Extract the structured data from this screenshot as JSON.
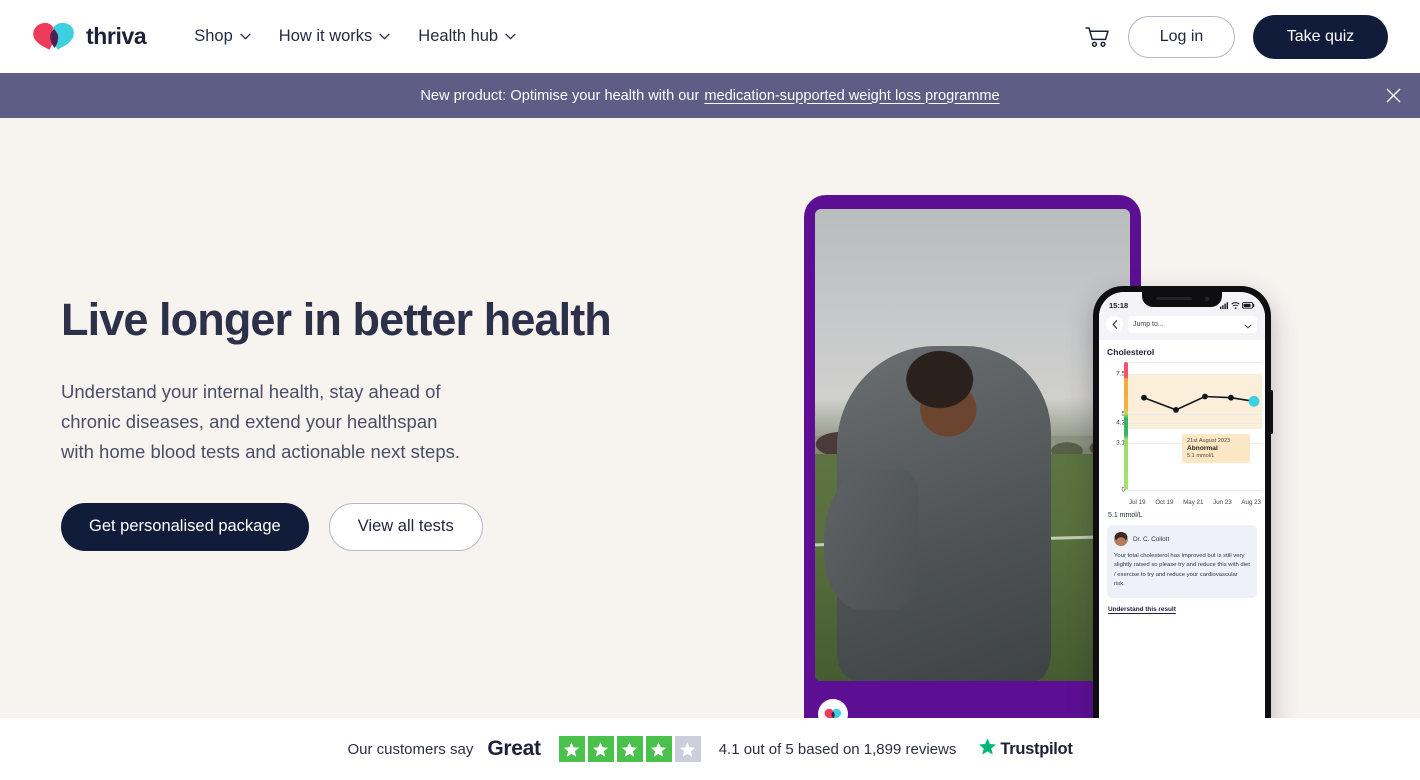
{
  "header": {
    "brand_name": "thriva",
    "logo_icon": "thriva-heart-logo",
    "nav": [
      {
        "label": "Shop",
        "icon": "chevron-down-icon"
      },
      {
        "label": "How it works",
        "icon": "chevron-down-icon"
      },
      {
        "label": "Health hub",
        "icon": "chevron-down-icon"
      }
    ],
    "cart_icon": "shopping-cart-icon",
    "login_label": "Log in",
    "quiz_label": "Take quiz"
  },
  "banner": {
    "text": "New product: Optimise your health with our",
    "link_text": "medication-supported weight loss programme",
    "close_icon": "close-icon",
    "background": "#5d5d85"
  },
  "hero": {
    "title": "Live longer in better health",
    "subtitle": "Understand your internal health, stay ahead of chronic diseases, and extend your healthspan with home blood tests and actionable next steps.",
    "subtitle_lines": [
      "Understand your internal health, stay ahead of",
      "chronic diseases, and extend your healthspan",
      "with home blood tests and actionable next steps."
    ],
    "primary_cta": "Get personalised package",
    "secondary_cta": "View all tests",
    "background": "#f7f3ef",
    "frame_color": "#5d0f94",
    "photo_alt": "Man laughing outdoors on a grass sports field",
    "badge_icon": "thriva-heart-logo"
  },
  "phone": {
    "status_time": "15:18",
    "status_icons": [
      "signal-icon",
      "wifi-icon",
      "battery-icon"
    ],
    "back_icon": "chevron-left-icon",
    "jump_to_label": "Jump to...",
    "jump_to_icon": "chevron-down-icon",
    "screen_title": "Cholesterol",
    "result_value": "5.1 mmol/L",
    "tooltip": {
      "date": "21st August 2023",
      "status": "Abnormal",
      "value": "5.1 mmol/L"
    },
    "doctor": {
      "name": "Dr. C. Collott",
      "avatar_icon": "doctor-avatar",
      "comment": "Your total cholesterol has improved but is still very slightly raised so please try and reduce this with diet / exercise to try and reduce your cardiovascular risk."
    },
    "understand_link": "Understand this result",
    "accent_highlight": "#3fd0e0"
  },
  "chart_data": {
    "type": "line",
    "title": "Cholesterol",
    "xlabel": "",
    "ylabel": "mmol/L",
    "categories": [
      "Jul 19",
      "Oct 19",
      "May 21",
      "Jun 23",
      "Aug 23"
    ],
    "values": [
      5.4,
      4.6,
      5.5,
      5.4,
      5.1
    ],
    "ylim": [
      0,
      8.4
    ],
    "yticks": [
      0,
      3.1,
      4.3,
      5,
      7.5
    ],
    "ytick_labels": [
      "0",
      "3.1",
      "4.3",
      "5",
      "7.5"
    ],
    "grid": true,
    "legend": "none",
    "highlight_point": {
      "index": 4,
      "label": "Aug 23",
      "value": 5.1,
      "color": "#3fd0e0"
    },
    "shaded_band": {
      "from": 4.3,
      "to": 7.5,
      "color": "#fbefd9",
      "meaning": "Abnormal range"
    },
    "reference_bar": [
      {
        "color": "#f4526b",
        "from": 7.5,
        "to": 8.4
      },
      {
        "color": "#f1b33f",
        "from": 5.0,
        "to": 7.5
      },
      {
        "color": "#35b56a",
        "from": 3.1,
        "to": 4.3
      },
      {
        "color": "#a8e06a",
        "from": 0,
        "to": 3.1
      }
    ],
    "annotation": {
      "date": "21st August 2023",
      "status": "Abnormal",
      "value": "5.1 mmol/L"
    }
  },
  "trustpilot": {
    "lead": "Our customers say",
    "rating_word": "Great",
    "stars_filled": 4,
    "stars_total": 5,
    "star_color": "#4ac14a",
    "star_empty_color": "#cdcedb",
    "summary": "4.1 out of 5 based on 1,899 reviews",
    "logo_text": "Trustpilot",
    "logo_icon": "trustpilot-star-icon",
    "logo_color": "#00b67a"
  }
}
